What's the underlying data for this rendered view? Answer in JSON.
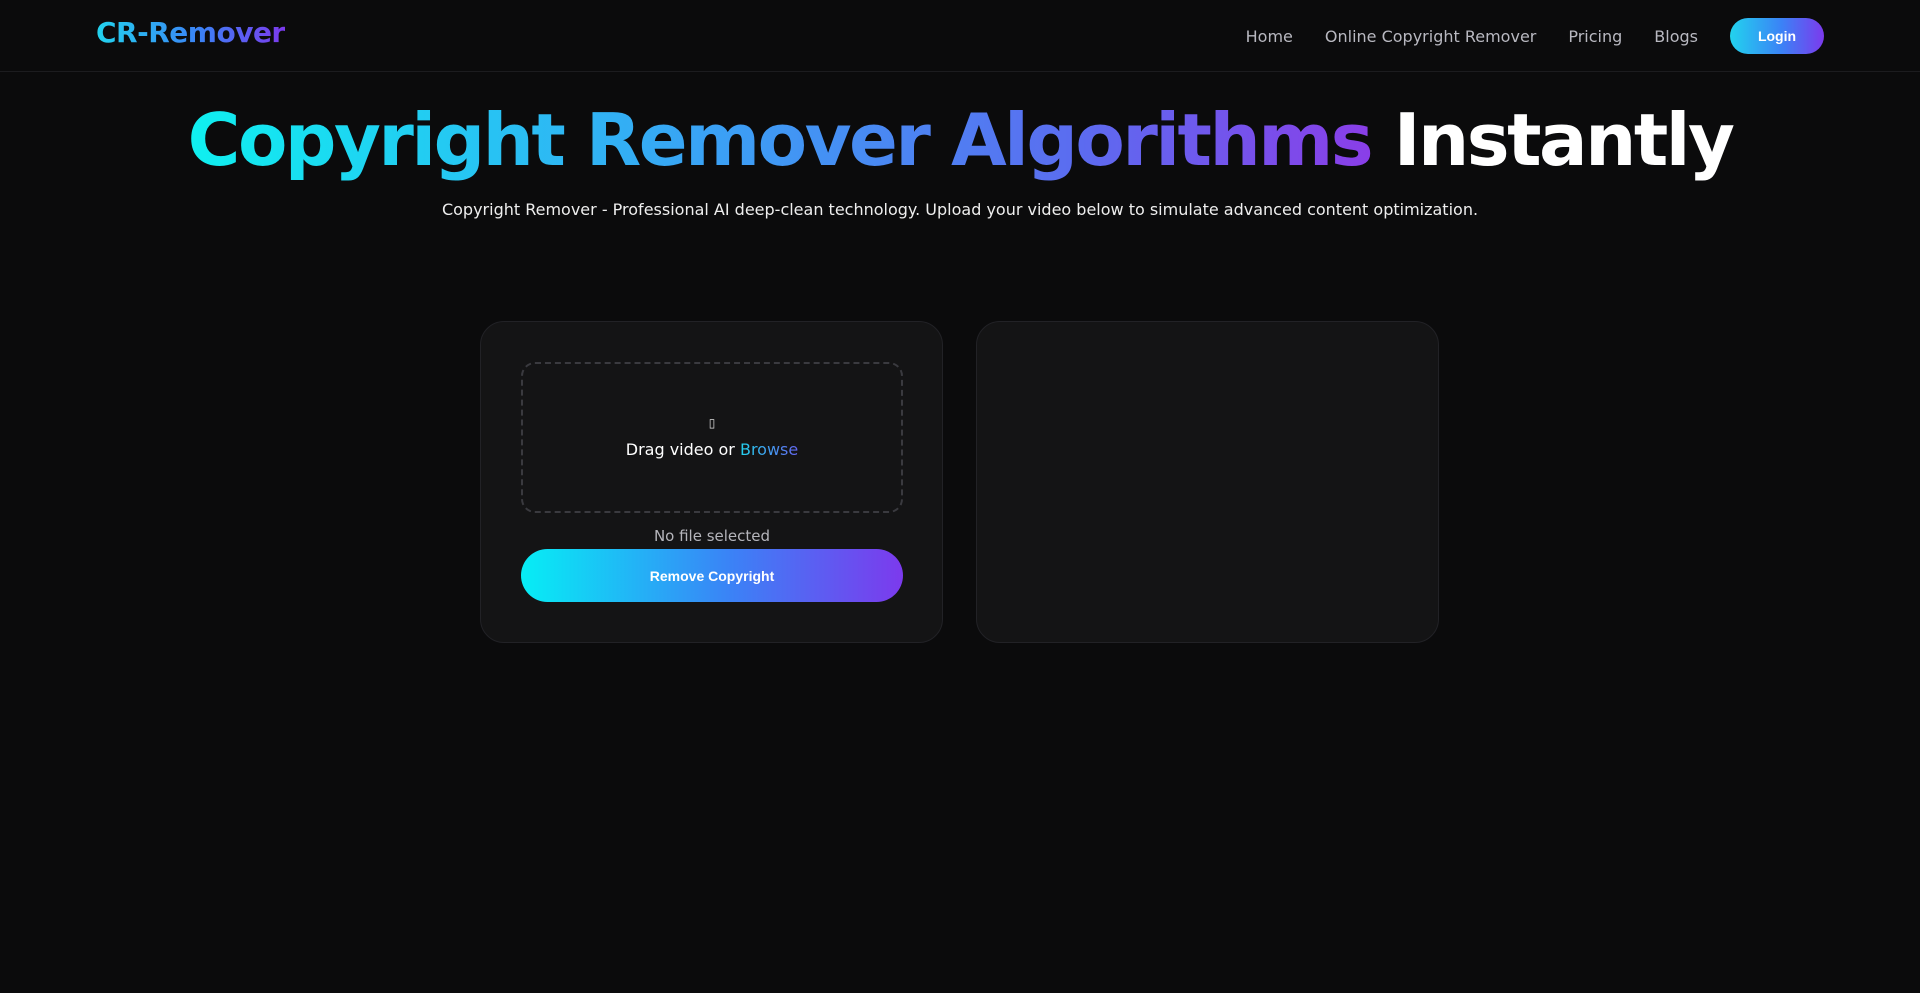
{
  "nav": {
    "logo": "CR-Remover",
    "links": [
      "Home",
      "Online Copyright Remover",
      "Pricing",
      "Blogs"
    ],
    "login_label": "Login"
  },
  "hero": {
    "title_gradient": "Copyright Remover Algorithms",
    "title_plain": "Instantly",
    "subtitle": "Copyright Remover - Professional AI deep-clean technology. Upload your video below to simulate advanced content optimization."
  },
  "uploader": {
    "icon": "upload-icon",
    "icon_glyph": "▯",
    "drop_text": "Drag video or",
    "browse_label": "Browse",
    "file_status": "No file selected",
    "action_label": "Remove Copyright"
  },
  "colors": {
    "background": "#0b0b0c",
    "card": "#141415",
    "gradient_start": "#22d3ee",
    "gradient_mid": "#3b82f6",
    "gradient_end": "#7c3aed"
  }
}
